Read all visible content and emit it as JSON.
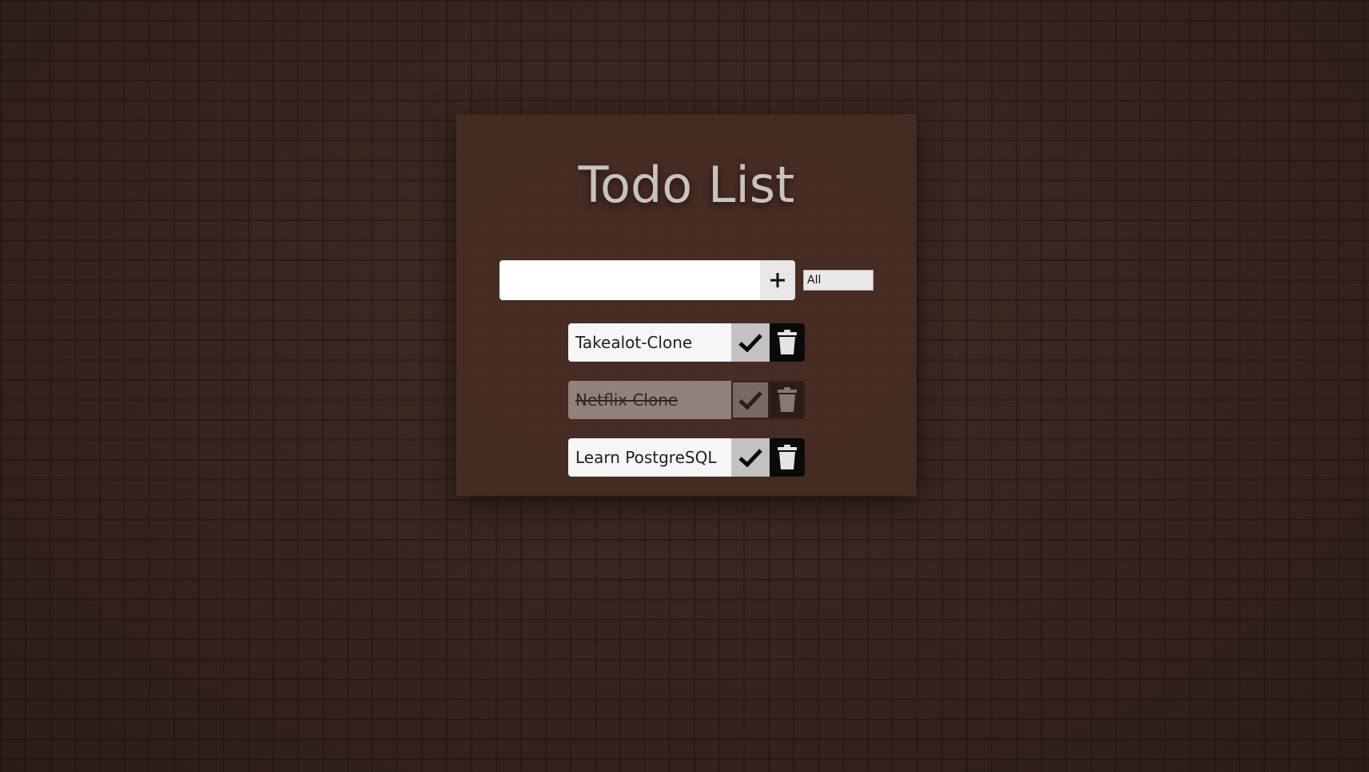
{
  "app": {
    "title": "Todo List"
  },
  "add_form": {
    "input_value": "",
    "input_placeholder": "",
    "add_icon": "plus-icon",
    "filter_selected": "All"
  },
  "todos": [
    {
      "text": "Takealot-Clone",
      "completed": false
    },
    {
      "text": "Netflix Clone",
      "completed": true
    },
    {
      "text": "Learn PostgreSQL",
      "completed": false
    }
  ],
  "icons": {
    "complete": "check-icon",
    "delete": "trash-icon"
  },
  "colors": {
    "card_background": "#462c24",
    "title": "#c9c3c0",
    "item_background": "#f7f6f6",
    "check_button": "#c3c1c1",
    "trash_button": "#0a0a0a"
  }
}
